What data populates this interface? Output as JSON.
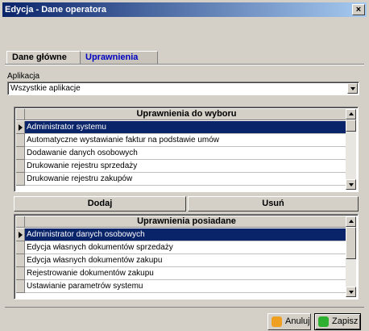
{
  "window": {
    "title": "Edycja - Dane operatora",
    "close_glyph": "×"
  },
  "tabs": [
    {
      "label": "Dane główne",
      "active": false
    },
    {
      "label": "Uprawnienia",
      "active": true
    }
  ],
  "application": {
    "label": "Aplikacja",
    "value": "Wszystkie aplikacje"
  },
  "available": {
    "header": "Uprawnienia do wyboru",
    "rows": [
      "Administrator systemu",
      "Automatyczne wystawianie faktur na podstawie umów",
      "Dodawanie danych osobowych",
      "Drukowanie rejestru sprzedaży",
      "Drukowanie rejestru zakupów"
    ],
    "selected_index": 0
  },
  "actions": {
    "add_label": "Dodaj",
    "remove_label": "Usuń"
  },
  "granted": {
    "header": "Uprawnienia posiadane",
    "rows": [
      "Administrator danych osobowych",
      "Edycja własnych dokumentów sprzedaży",
      "Edycja własnych dokumentów zakupu",
      "Rejestrowanie dokumentów zakupu",
      "Ustawianie parametrów systemu"
    ],
    "selected_index": 0
  },
  "footer": {
    "cancel_label": "Anuluj",
    "save_label": "Zapisz",
    "cancel_icon": "cancel-icon",
    "save_icon": "save-icon",
    "cancel_icon_color": "#f0a020",
    "save_icon_color": "#30b030"
  },
  "colors": {
    "selection": "#0a246a",
    "tab_active_text": "#0000c0",
    "titlebar_start": "#0a246a"
  }
}
